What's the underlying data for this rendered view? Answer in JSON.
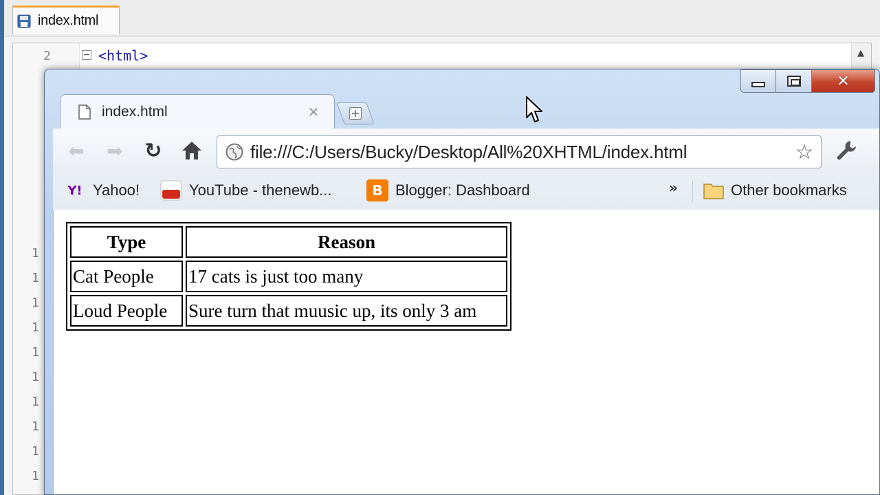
{
  "editor": {
    "tab_label": "index.html",
    "first_line_number": "2",
    "first_line_code": "<html>",
    "peek_line_numbers": [
      "1",
      "1",
      "1",
      "1",
      "1",
      "1",
      "1",
      "1",
      "1",
      "1"
    ]
  },
  "browser": {
    "tab_title": "index.html",
    "url": "file:///C:/Users/Bucky/Desktop/All%20XHTML/index.html",
    "bookmarks": {
      "yahoo": "Yahoo!",
      "youtube": "YouTube - thenewb...",
      "blogger": "Blogger: Dashboard",
      "more": "»",
      "other": "Other bookmarks"
    },
    "table": {
      "headers": [
        "Type",
        "Reason"
      ],
      "rows": [
        [
          "Cat People",
          "17 cats is just too many"
        ],
        [
          "Loud People",
          "Sure turn that muusic up, its only 3 am"
        ]
      ]
    }
  },
  "colors": {
    "accent_tab": "#f2a438",
    "close_button": "#c4452d",
    "yahoo": "#7b0099",
    "blogger": "#f57d00"
  }
}
